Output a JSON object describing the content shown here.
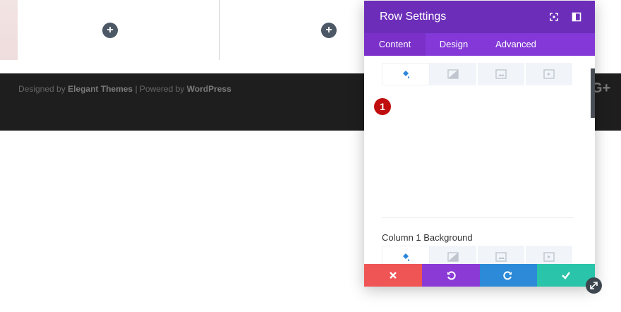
{
  "page": {
    "add_glyph": "+",
    "footer": {
      "designed_by_prefix": "Designed by",
      "designed_by_name": "Elegant Themes",
      "separator": "|",
      "powered_by_prefix": "Powered by",
      "powered_by_name": "WordPress",
      "social_glyph": "G+"
    }
  },
  "modal": {
    "title": "Row Settings",
    "header_icons": [
      "fullscreen-icon",
      "sidebar-toggle-icon"
    ],
    "tabs": [
      {
        "label": "Content",
        "active": true
      },
      {
        "label": "Design",
        "active": false
      },
      {
        "label": "Advanced",
        "active": false
      }
    ],
    "background_tabs": [
      "color-fill-icon",
      "gradient-icon",
      "image-icon",
      "video-icon"
    ],
    "step_badge": "1",
    "section_label": "Column 1 Background",
    "footer_buttons": [
      {
        "name": "discard",
        "icon": "close-icon",
        "color": "#ef5555"
      },
      {
        "name": "undo",
        "icon": "undo-icon",
        "color": "#8b3ad6"
      },
      {
        "name": "redo",
        "icon": "redo-icon",
        "color": "#2c8ad8"
      },
      {
        "name": "save",
        "icon": "check-icon",
        "color": "#29c4a9"
      }
    ]
  },
  "colors": {
    "header": "#6c2eb9",
    "tabs_bar": "#8338d7",
    "footer_bg": "#1e1e1e",
    "badge": "#c00d0d"
  }
}
